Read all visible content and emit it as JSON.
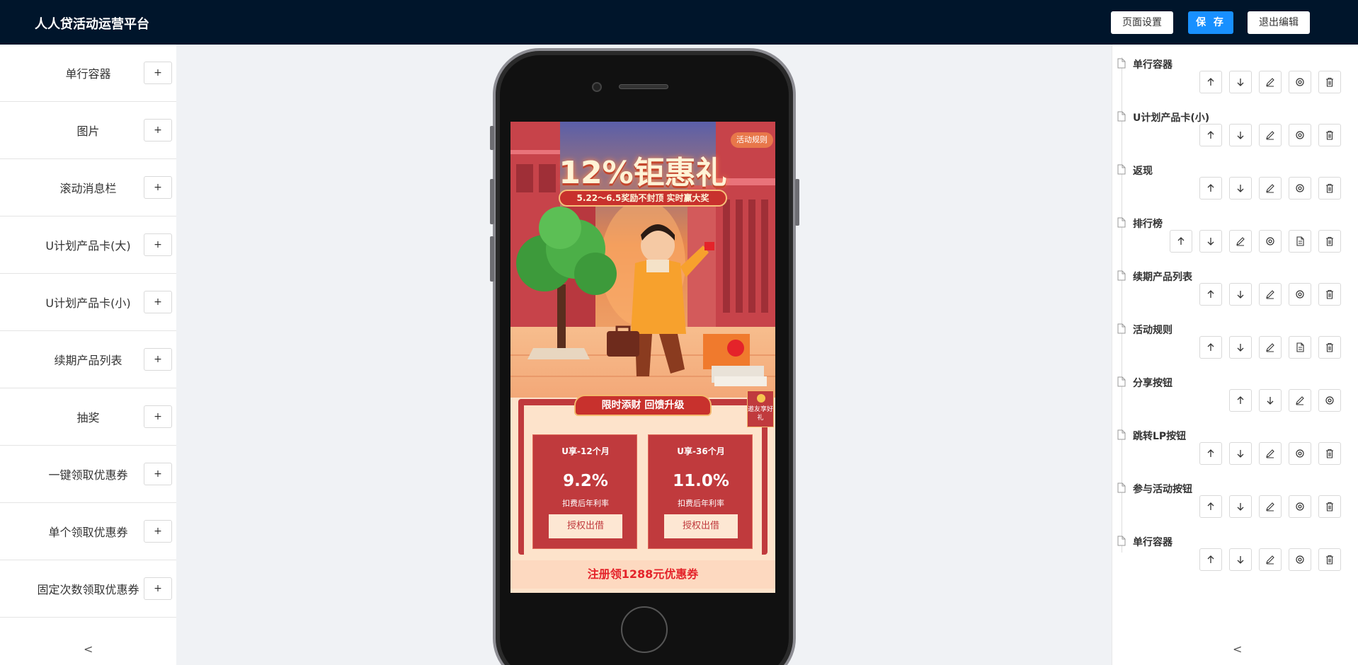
{
  "header": {
    "app_title": "人人贷活动运营平台",
    "page_settings_label": "页面设置",
    "save_label": "保 存",
    "exit_label": "退出编辑"
  },
  "components": {
    "add_label": "+",
    "collapse_label": "<",
    "items": [
      {
        "label": "单行容器"
      },
      {
        "label": "图片"
      },
      {
        "label": "滚动消息栏"
      },
      {
        "label": "U计划产品卡(大)"
      },
      {
        "label": "U计划产品卡(小)"
      },
      {
        "label": "续期产品列表"
      },
      {
        "label": "抽奖"
      },
      {
        "label": "一键领取优惠券"
      },
      {
        "label": "单个领取优惠券"
      },
      {
        "label": "固定次数领取优惠券"
      }
    ]
  },
  "layers": {
    "collapse_label": "<",
    "items": [
      {
        "label": "单行容器",
        "actions": [
          "arrow-up-icon",
          "arrow-down-icon",
          "edit-icon",
          "settings-icon",
          "delete-icon"
        ]
      },
      {
        "label": "U计划产品卡(小)",
        "actions": [
          "arrow-up-icon",
          "arrow-down-icon",
          "edit-icon",
          "settings-icon",
          "delete-icon"
        ]
      },
      {
        "label": "返现",
        "actions": [
          "arrow-up-icon",
          "arrow-down-icon",
          "edit-icon",
          "settings-icon",
          "delete-icon"
        ]
      },
      {
        "label": "排行榜",
        "actions": [
          "arrow-up-icon",
          "arrow-down-icon",
          "edit-icon",
          "settings-icon",
          "document-icon",
          "delete-icon"
        ]
      },
      {
        "label": "续期产品列表",
        "actions": [
          "arrow-up-icon",
          "arrow-down-icon",
          "edit-icon",
          "settings-icon",
          "delete-icon"
        ]
      },
      {
        "label": "活动规则",
        "actions": [
          "arrow-up-icon",
          "arrow-down-icon",
          "edit-icon",
          "document-icon",
          "delete-icon"
        ]
      },
      {
        "label": "分享按钮",
        "actions": [
          "arrow-up-icon",
          "arrow-down-icon",
          "edit-icon",
          "settings-icon"
        ]
      },
      {
        "label": "跳转LP按钮",
        "actions": [
          "arrow-up-icon",
          "arrow-down-icon",
          "edit-icon",
          "settings-icon",
          "delete-icon"
        ]
      },
      {
        "label": "参与活动按钮",
        "actions": [
          "arrow-up-icon",
          "arrow-down-icon",
          "edit-icon",
          "settings-icon",
          "delete-icon"
        ]
      },
      {
        "label": "单行容器",
        "actions": [
          "arrow-up-icon",
          "arrow-down-icon",
          "edit-icon",
          "settings-icon",
          "delete-icon"
        ]
      }
    ]
  },
  "preview": {
    "rules_tag": "活动规则",
    "hero_title": "12%钜惠礼",
    "hero_subtitle": "5.22～6.5奖励不封顶 实时赢大奖",
    "card_header": "限时添财 回馈升级",
    "invite_label": "邀友享好礼",
    "products": [
      {
        "name": "U享-12个月",
        "rate": "9.2%",
        "desc": "扣费后年利率",
        "button": "授权出借"
      },
      {
        "name": "U享-36个月",
        "rate": "11.0%",
        "desc": "扣费后年利率",
        "button": "授权出借"
      }
    ],
    "coupon_text": "注册领1288元优惠券"
  },
  "colors": {
    "header_bg": "#00152b",
    "primary": "#1890ff",
    "brand_red": "#c03a3d",
    "coupon_red": "#e4232a"
  }
}
